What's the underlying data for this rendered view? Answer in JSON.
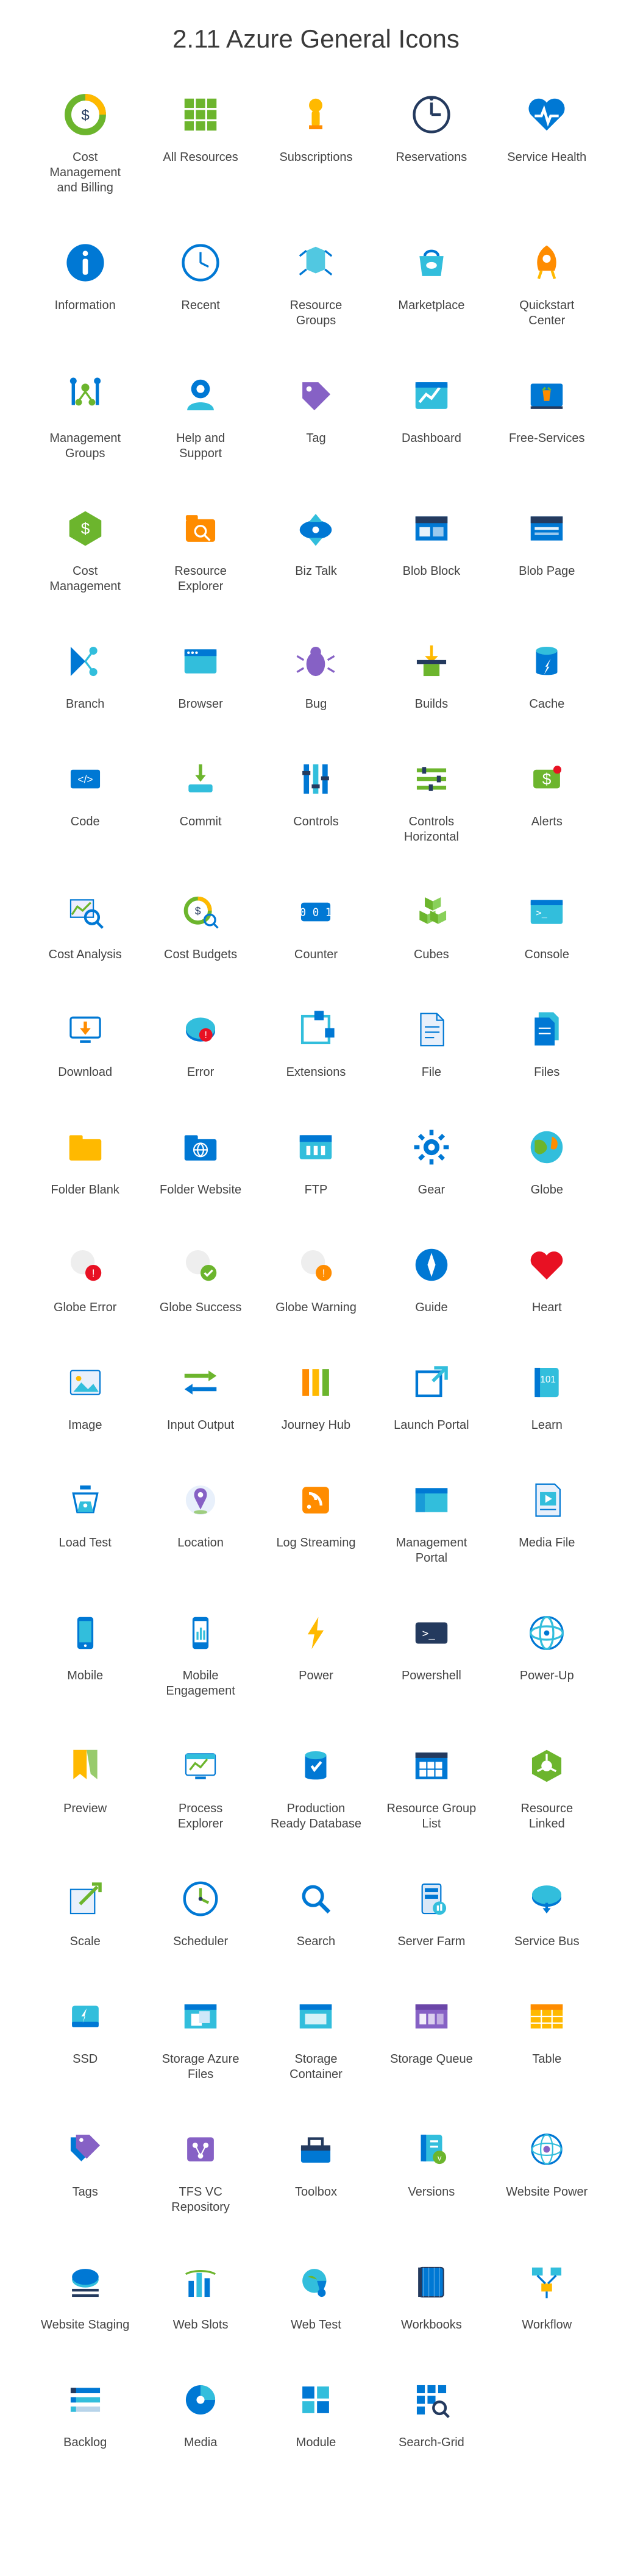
{
  "title": "2.11 Azure General Icons",
  "icons": [
    {
      "id": "cost-management-and-billing",
      "label": "Cost Management and Billing"
    },
    {
      "id": "all-resources",
      "label": "All Resources"
    },
    {
      "id": "subscriptions",
      "label": "Subscriptions"
    },
    {
      "id": "reservations",
      "label": "Reservations"
    },
    {
      "id": "service-health",
      "label": "Service Health"
    },
    {
      "id": "information",
      "label": "Information"
    },
    {
      "id": "recent",
      "label": "Recent"
    },
    {
      "id": "resource-groups",
      "label": "Resource Groups"
    },
    {
      "id": "marketplace",
      "label": "Marketplace"
    },
    {
      "id": "quickstart-center",
      "label": "Quickstart Center"
    },
    {
      "id": "management-groups",
      "label": "Management Groups"
    },
    {
      "id": "help-and-support",
      "label": "Help and Support"
    },
    {
      "id": "tag",
      "label": "Tag"
    },
    {
      "id": "dashboard",
      "label": "Dashboard"
    },
    {
      "id": "free-services",
      "label": "Free-Services"
    },
    {
      "id": "cost-management",
      "label": "Cost Management"
    },
    {
      "id": "resource-explorer",
      "label": "Resource Explorer"
    },
    {
      "id": "biz-talk",
      "label": "Biz Talk"
    },
    {
      "id": "blob-block",
      "label": "Blob Block"
    },
    {
      "id": "blob-page",
      "label": "Blob Page"
    },
    {
      "id": "branch",
      "label": "Branch"
    },
    {
      "id": "browser",
      "label": "Browser"
    },
    {
      "id": "bug",
      "label": "Bug"
    },
    {
      "id": "builds",
      "label": "Builds"
    },
    {
      "id": "cache",
      "label": "Cache"
    },
    {
      "id": "code",
      "label": "Code"
    },
    {
      "id": "commit",
      "label": "Commit"
    },
    {
      "id": "controls",
      "label": "Controls"
    },
    {
      "id": "controls-horizontal",
      "label": "Controls Horizontal"
    },
    {
      "id": "alerts",
      "label": "Alerts"
    },
    {
      "id": "cost-analysis",
      "label": "Cost Analysis"
    },
    {
      "id": "cost-budgets",
      "label": "Cost Budgets"
    },
    {
      "id": "counter",
      "label": "Counter"
    },
    {
      "id": "cubes",
      "label": "Cubes"
    },
    {
      "id": "console",
      "label": "Console"
    },
    {
      "id": "download",
      "label": "Download"
    },
    {
      "id": "error",
      "label": "Error"
    },
    {
      "id": "extensions",
      "label": "Extensions"
    },
    {
      "id": "file",
      "label": "File"
    },
    {
      "id": "files",
      "label": "Files"
    },
    {
      "id": "folder-blank",
      "label": "Folder Blank"
    },
    {
      "id": "folder-website",
      "label": "Folder Website"
    },
    {
      "id": "ftp",
      "label": "FTP"
    },
    {
      "id": "gear",
      "label": "Gear"
    },
    {
      "id": "globe",
      "label": "Globe"
    },
    {
      "id": "globe-error",
      "label": "Globe Error"
    },
    {
      "id": "globe-success",
      "label": "Globe Success"
    },
    {
      "id": "globe-warning",
      "label": "Globe Warning"
    },
    {
      "id": "guide",
      "label": "Guide"
    },
    {
      "id": "heart",
      "label": "Heart"
    },
    {
      "id": "image",
      "label": "Image"
    },
    {
      "id": "input-output",
      "label": "Input Output"
    },
    {
      "id": "journey-hub",
      "label": "Journey Hub"
    },
    {
      "id": "launch-portal",
      "label": "Launch Portal"
    },
    {
      "id": "learn",
      "label": "Learn"
    },
    {
      "id": "load-test",
      "label": "Load Test"
    },
    {
      "id": "location",
      "label": "Location"
    },
    {
      "id": "log-streaming",
      "label": "Log Streaming"
    },
    {
      "id": "management-portal",
      "label": "Management Portal"
    },
    {
      "id": "media-file",
      "label": "Media File"
    },
    {
      "id": "mobile",
      "label": "Mobile"
    },
    {
      "id": "mobile-engagement",
      "label": "Mobile Engagement"
    },
    {
      "id": "power",
      "label": "Power"
    },
    {
      "id": "powershell",
      "label": "Powershell"
    },
    {
      "id": "power-up",
      "label": "Power-Up"
    },
    {
      "id": "preview",
      "label": "Preview"
    },
    {
      "id": "process-explorer",
      "label": "Process Explorer"
    },
    {
      "id": "production-ready-database",
      "label": "Production Ready Database"
    },
    {
      "id": "resource-group-list",
      "label": "Resource Group List"
    },
    {
      "id": "resource-linked",
      "label": "Resource Linked"
    },
    {
      "id": "scale",
      "label": "Scale"
    },
    {
      "id": "scheduler",
      "label": "Scheduler"
    },
    {
      "id": "search",
      "label": "Search"
    },
    {
      "id": "server-farm",
      "label": "Server Farm"
    },
    {
      "id": "service-bus",
      "label": "Service Bus"
    },
    {
      "id": "ssd",
      "label": "SSD"
    },
    {
      "id": "storage-azure-files",
      "label": "Storage Azure Files"
    },
    {
      "id": "storage-container",
      "label": "Storage Container"
    },
    {
      "id": "storage-queue",
      "label": "Storage Queue"
    },
    {
      "id": "table",
      "label": "Table"
    },
    {
      "id": "tags",
      "label": "Tags"
    },
    {
      "id": "tfs-vc-repository",
      "label": "TFS VC Repository"
    },
    {
      "id": "toolbox",
      "label": "Toolbox"
    },
    {
      "id": "versions",
      "label": "Versions"
    },
    {
      "id": "website-power",
      "label": "Website Power"
    },
    {
      "id": "website-staging",
      "label": "Website Staging"
    },
    {
      "id": "web-slots",
      "label": "Web Slots"
    },
    {
      "id": "web-test",
      "label": "Web Test"
    },
    {
      "id": "workbooks",
      "label": "Workbooks"
    },
    {
      "id": "workflow",
      "label": "Workflow"
    },
    {
      "id": "backlog",
      "label": "Backlog"
    },
    {
      "id": "media",
      "label": "Media"
    },
    {
      "id": "module",
      "label": "Module"
    },
    {
      "id": "search-grid",
      "label": "Search-Grid"
    }
  ],
  "colors": {
    "azure_blue": "#0078d4",
    "azure_teal": "#32bedc",
    "azure_green": "#6cb52d",
    "azure_orange": "#ff8c00",
    "azure_yellow": "#ffb900",
    "azure_purple": "#8661c5",
    "azure_red": "#e81123",
    "dark_blue": "#243a5e"
  }
}
